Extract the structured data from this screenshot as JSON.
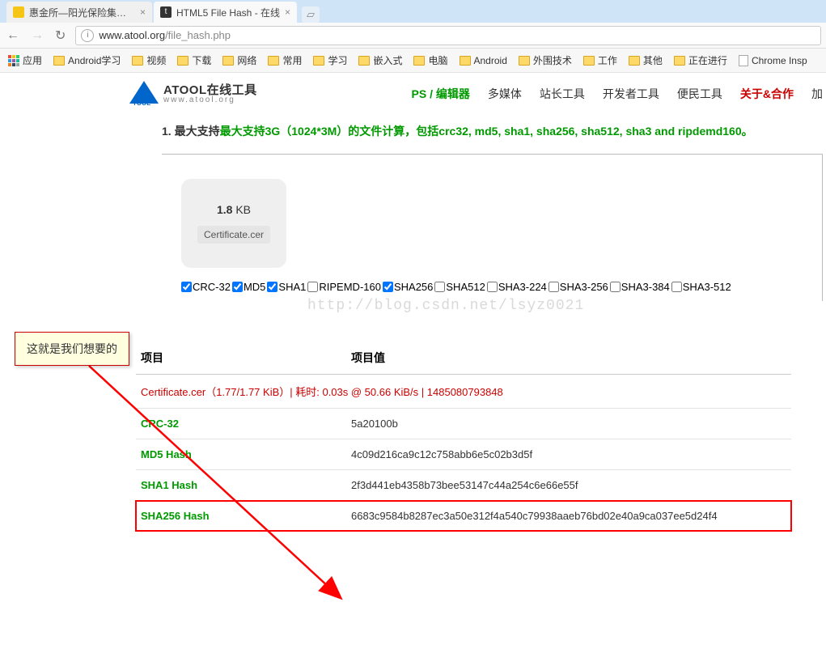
{
  "browser": {
    "tabs": [
      {
        "title": "惠金所—阳光保险集团旗",
        "favicon_color": "#f5c518"
      },
      {
        "title": "HTML5 File Hash - 在线",
        "favicon_color": "#333"
      }
    ],
    "url_host": "www.atool.org",
    "url_path": "/file_hash.php",
    "nav": {
      "back": "←",
      "forward": "→",
      "reload": "↻"
    },
    "bookmarks": {
      "apps": "应用",
      "items": [
        "Android学习",
        "视频",
        "下载",
        "网络",
        "常用",
        "学习",
        "嵌入式",
        "电脑",
        "Android",
        "外围技术",
        "工作",
        "其他",
        "正在进行"
      ],
      "page_link": "Chrome Insp"
    }
  },
  "header": {
    "brand_top": "ATOOL在线工具",
    "brand_sub": "www.atool.org",
    "nav": [
      {
        "label": "PS / 编辑器",
        "cls": "green"
      },
      {
        "label": "多媒体",
        "cls": ""
      },
      {
        "label": "站长工具",
        "cls": ""
      },
      {
        "label": "开发者工具",
        "cls": ""
      },
      {
        "label": "便民工具",
        "cls": ""
      },
      {
        "label": "关于&合作",
        "cls": "red"
      },
      {
        "label": "加",
        "cls": ""
      }
    ]
  },
  "intro": {
    "prefix": "1. 最大支持",
    "green": "最大支持3G（1024*3M）的文件计算，包括crc32, md5, sha1, sha256, sha512, sha3 and ripdemd160。"
  },
  "file": {
    "size_num": "1.8",
    "size_unit": "KB",
    "name": "Certificate.cer"
  },
  "watermark": "http://blog.csdn.net/lsyz0021",
  "algos": [
    {
      "label": "CRC-32",
      "checked": true
    },
    {
      "label": "MD5",
      "checked": true
    },
    {
      "label": "SHA1",
      "checked": true
    },
    {
      "label": "RIPEMD-160",
      "checked": false
    },
    {
      "label": "SHA256",
      "checked": true
    },
    {
      "label": "SHA512",
      "checked": false
    },
    {
      "label": "SHA3-224",
      "checked": false
    },
    {
      "label": "SHA3-256",
      "checked": false
    },
    {
      "label": "SHA3-384",
      "checked": false
    },
    {
      "label": "SHA3-512",
      "checked": false
    }
  ],
  "table": {
    "headers": {
      "item": "项目",
      "value": "项目值"
    },
    "fileinfo": "Certificate.cer（1.77/1.77 KiB）| 耗时: 0.03s @ 50.66 KiB/s | 1485080793848",
    "rows": [
      {
        "k": "CRC-32",
        "v": "5a20100b"
      },
      {
        "k": "MD5 Hash",
        "v": "4c09d216ca9c12c758abb6e5c02b3d5f"
      },
      {
        "k": "SHA1 Hash",
        "v": "2f3d441eb4358b73bee53147c44a254c6e66e55f"
      },
      {
        "k": "SHA256 Hash",
        "v": "6683c9584b8287ec3a50e312f4a540c79938aaeb76bd02e40a9ca037ee5d24f4",
        "hl": true
      }
    ]
  },
  "callout": "这就是我们想要的"
}
